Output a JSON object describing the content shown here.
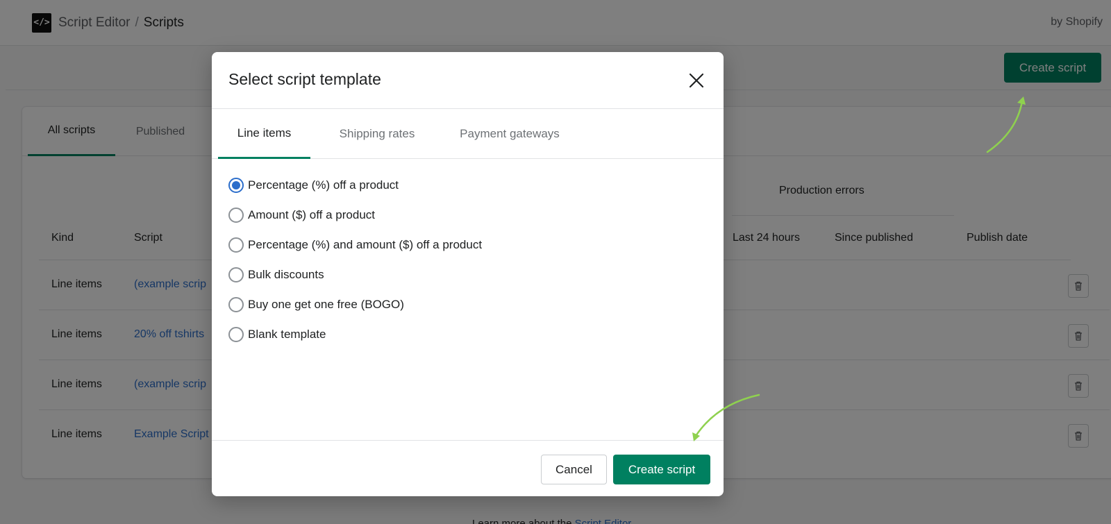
{
  "app": {
    "logo_glyph": "</>",
    "breadcrumb_app": "Script Editor",
    "breadcrumb_sep": "/",
    "breadcrumb_page": "Scripts",
    "byline": "by Shopify"
  },
  "toolbar": {
    "create_label": "Create script"
  },
  "list": {
    "tabs": [
      "All scripts",
      "Published"
    ],
    "group_header": "Production errors",
    "columns": {
      "kind": "Kind",
      "script": "Script",
      "last24": "Last 24 hours",
      "since_published": "Since published",
      "publish_date": "Publish date"
    },
    "rows": [
      {
        "kind": "Line items",
        "script": "(example scrip"
      },
      {
        "kind": "Line items",
        "script": "20% off tshirts"
      },
      {
        "kind": "Line items",
        "script": "(example scrip"
      },
      {
        "kind": "Line items",
        "script": "Example Script"
      }
    ]
  },
  "footer": {
    "learn_text": "Learn more about the",
    "learn_link": "Script Editor"
  },
  "modal": {
    "title": "Select script template",
    "tabs": [
      "Line items",
      "Shipping rates",
      "Payment gateways"
    ],
    "options": [
      "Percentage (%) off a product",
      "Amount ($) off a product",
      "Percentage (%) and amount ($) off a product",
      "Bulk discounts",
      "Buy one get one free (BOGO)",
      "Blank template"
    ],
    "selected_index": 0,
    "cancel_label": "Cancel",
    "create_label": "Create script"
  },
  "colors": {
    "primary": "#008060",
    "link": "#2c6ecb",
    "annotation_arrow": "#8fd14f"
  }
}
